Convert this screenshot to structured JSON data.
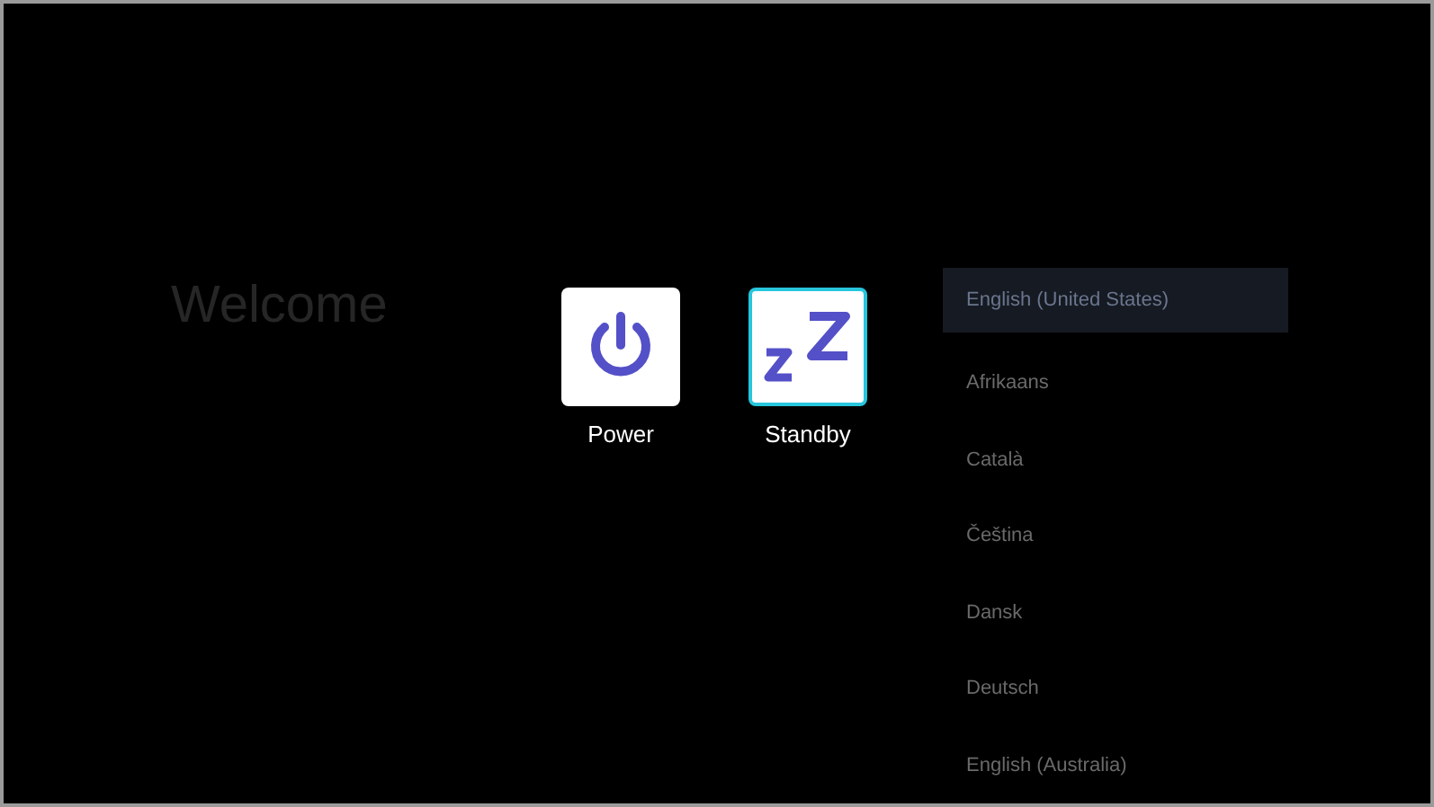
{
  "title": "Welcome",
  "options": [
    {
      "label": "Power",
      "kind": "power",
      "selected": false
    },
    {
      "label": "Standby",
      "kind": "standby",
      "selected": true
    }
  ],
  "languages": [
    {
      "label": "English (United States)",
      "selected": true
    },
    {
      "label": "Afrikaans",
      "selected": false
    },
    {
      "label": "Català",
      "selected": false
    },
    {
      "label": "Čeština",
      "selected": false
    },
    {
      "label": "Dansk",
      "selected": false
    },
    {
      "label": "Deutsch",
      "selected": false
    },
    {
      "label": "English (Australia)",
      "selected": false
    }
  ]
}
